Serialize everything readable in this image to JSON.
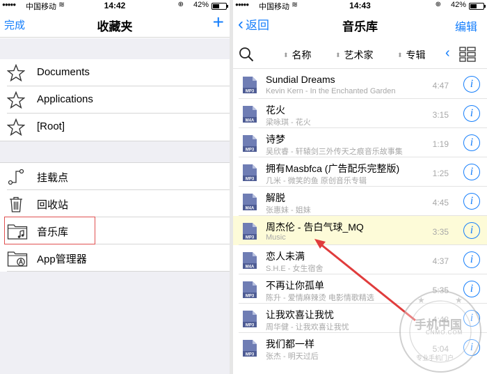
{
  "left": {
    "status": {
      "signal": "●●●●●",
      "carrier": "中国移动",
      "wifi": "≋",
      "time": "14:42",
      "lock": "⊕",
      "battery": "42%",
      "battery_level": 0.42
    },
    "nav": {
      "left": "完成",
      "title": "收藏夹",
      "right": "+"
    },
    "favorites": [
      "Documents",
      "Applications",
      "[Root]"
    ],
    "places": [
      "挂载点",
      "回收站",
      "音乐库",
      "App管理器"
    ]
  },
  "right": {
    "status": {
      "signal": "●●●●●",
      "carrier": "中国移动",
      "wifi": "≋",
      "time": "14:43",
      "lock": "⊕",
      "battery": "42%",
      "battery_level": 0.42
    },
    "nav": {
      "back": "返回",
      "title": "音乐库",
      "right": "编辑"
    },
    "sort": {
      "name": "名称",
      "artist": "艺术家",
      "album": "专辑"
    },
    "tracks": [
      {
        "title": "Sundial Dreams",
        "subtitle": "Kevin Kern - In the Enchanted Garden",
        "duration": "4:47",
        "format": "MP3"
      },
      {
        "title": "花火",
        "subtitle": "梁咏琪 - 花火",
        "duration": "3:15",
        "format": "M4A"
      },
      {
        "title": "诗梦",
        "subtitle": "吴欣睿 - 轩辕剑三外传天之痕音乐故事集",
        "duration": "1:19",
        "format": "MP3"
      },
      {
        "title": "拥有Masbfca (广告配乐完整版)",
        "subtitle": "几米 - 微笑的鱼 原创音乐专辑",
        "duration": "1:25",
        "format": "MP3"
      },
      {
        "title": "解脱",
        "subtitle": "张惠妹 - 姐妹",
        "duration": "4:45",
        "format": "M4A"
      },
      {
        "title": "周杰伦 - 告白气球_MQ",
        "subtitle": "Music",
        "duration": "3:35",
        "format": "MP3"
      },
      {
        "title": "恋人未满",
        "subtitle": "S.H.E - 女生宿舍",
        "duration": "4:37",
        "format": "M4A"
      },
      {
        "title": "不再让你孤单",
        "subtitle": "陈升 - 爱情麻辣烫 电影情歌精选",
        "duration": "5:35",
        "format": "MP3"
      },
      {
        "title": "让我欢喜让我忧",
        "subtitle": "周华健 - 让我欢喜让我忧",
        "duration": "4:48",
        "format": "MP3"
      },
      {
        "title": "我们都一样",
        "subtitle": "张杰 - 明天过后",
        "duration": "5:04",
        "format": "MP3"
      }
    ],
    "info_glyph": "i"
  },
  "watermark": {
    "text": "手机中国",
    "sub": "CNMO.COM",
    "ring": "专业手机门户"
  },
  "colors": {
    "accent": "#157efb",
    "highlight_row": "#fdfbd8",
    "annotation": "#e03c3c",
    "group_bg": "#efeff4"
  }
}
